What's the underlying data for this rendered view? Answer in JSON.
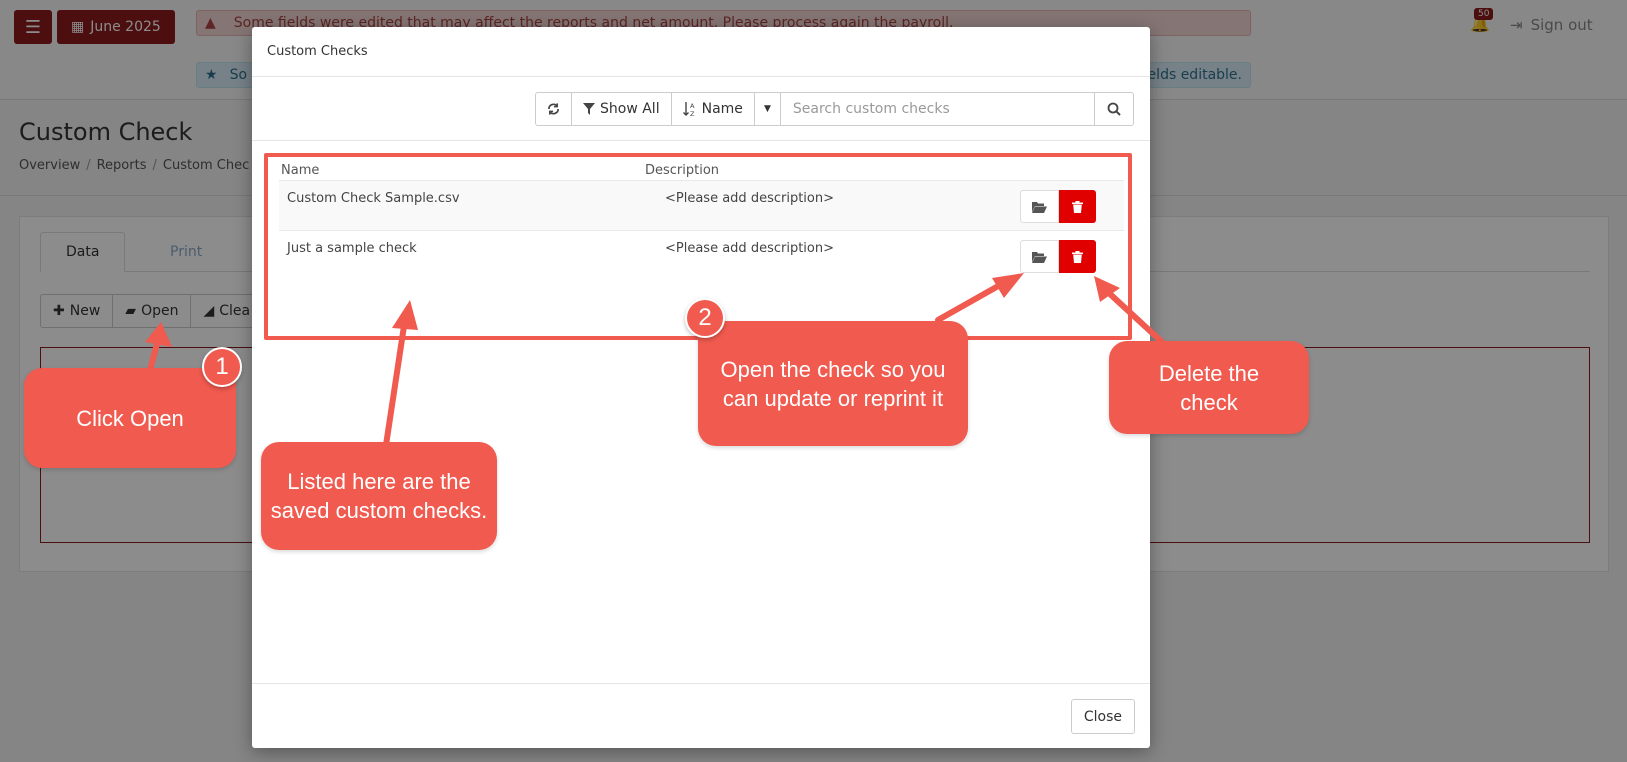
{
  "header": {
    "period_label": "June 2025",
    "warning_text": "Some fields were edited that may affect the reports and net amount. Please process again the payroll.",
    "info_text_start": "So",
    "info_text_end": "ields editable.",
    "notification_count": "50",
    "signout_label": "Sign out"
  },
  "page": {
    "title": "Custom Check",
    "breadcrumb": [
      "Overview",
      "Reports",
      "Custom Chec"
    ],
    "tabs": [
      "Data",
      "Print"
    ],
    "toolbar": {
      "new_label": "New",
      "open_label": "Open",
      "clear_label": "Clea"
    }
  },
  "modal": {
    "title": "Custom Checks",
    "toolbar": {
      "show_all_label": "Show All",
      "sort_label": "Name",
      "search_placeholder": "Search custom checks"
    },
    "columns": [
      "Name",
      "Description"
    ],
    "rows": [
      {
        "name": "Custom Check Sample.csv",
        "description": "<Please add description>"
      },
      {
        "name": "Just a sample check",
        "description": "<Please add description>"
      }
    ],
    "close_label": "Close"
  },
  "annotations": {
    "badge_1": "1",
    "badge_2": "2",
    "click_open": "Click Open",
    "listed_here": "Listed here are the saved custom checks.",
    "open_check": "Open the check so you can update or reprint it",
    "delete_check": "Delete the check"
  },
  "colors": {
    "brand": "#8b1a1a",
    "callout": "#f05a4f",
    "delete": "#e00000"
  }
}
